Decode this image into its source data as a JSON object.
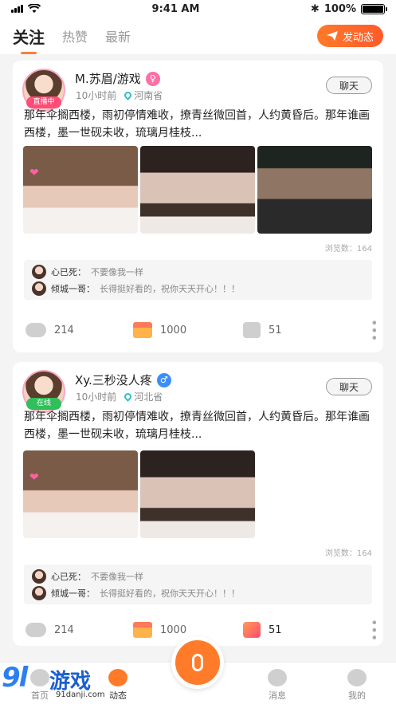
{
  "status_bar": {
    "time": "9:41 AM",
    "battery": "100%"
  },
  "tabs": [
    {
      "label": "关注",
      "active": true
    },
    {
      "label": "热赞",
      "active": false
    },
    {
      "label": "最新",
      "active": false
    }
  ],
  "post_button": "发动态",
  "posts": [
    {
      "username": "M.苏眉/游戏",
      "gender": "female",
      "badge": "直播中",
      "time": "10小时前",
      "location": "河南省",
      "chat_label": "聊天",
      "content": "那年伞搁西楼，雨初停情难收，撩青丝微回首，人约黄昏后。那年谁画西楼，墨一世砚未收，琉璃月桂枝...",
      "views": "浏览数：164",
      "comments": [
        {
          "name": "心已死：",
          "text": "不要像我一样"
        },
        {
          "name": "倾城一哥：",
          "text": "长得挺好看的，祝你天天开心！！！"
        }
      ],
      "comment_count": "214",
      "gift_count": "1000",
      "like_count": "51",
      "liked": false
    },
    {
      "username": "Xy.三秒没人疼",
      "gender": "male",
      "badge": "在线",
      "time": "10小时前",
      "location": "河北省",
      "chat_label": "聊天",
      "content": "那年伞搁西楼，雨初停情难收，撩青丝微回首，人约黄昏后。那年谁画西楼，墨一世砚未收，琉璃月桂枝...",
      "views": "浏览数：164",
      "comments": [
        {
          "name": "心已死：",
          "text": "不要像我一样"
        },
        {
          "name": "倾城一哥：",
          "text": "长得挺好看的，祝你天天开心！！！"
        }
      ],
      "comment_count": "214",
      "gift_count": "1000",
      "like_count": "51",
      "liked": true
    }
  ],
  "bottom_nav": [
    {
      "label": "首页"
    },
    {
      "label": "动态",
      "active": true
    },
    {
      "label": "消息"
    },
    {
      "label": "我的"
    }
  ],
  "watermark": {
    "logo": "9l",
    "name": "游戏",
    "url": "91danji.com"
  },
  "colors": {
    "accent": "#ff7b2a",
    "female": "#ff6ea6",
    "male": "#3b8ef7",
    "live_badge": "#ff4d78",
    "online_badge": "#2fbf5b"
  }
}
